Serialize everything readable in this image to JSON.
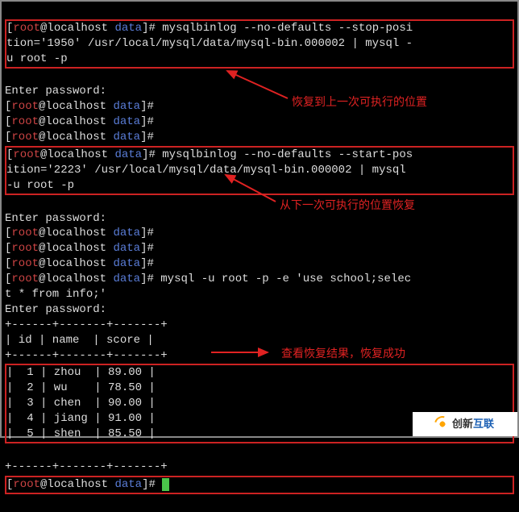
{
  "prompt": {
    "user": "root",
    "host": "localhost",
    "dir": "data"
  },
  "cmd1": "mysqlbinlog --no-defaults --stop-position='1950' /usr/local/mysql/data/mysql-bin.000002 | mysql -u root -p",
  "enter_pw": "Enter password:",
  "cmd2": "mysqlbinlog --no-defaults --start-position='2223' /usr/local/mysql/data/mysql-bin.000002 | mysql -u root -p",
  "cmd3": "mysql -u root -p -e 'use school;select * from info;'",
  "table": {
    "sep": "+------+-------+-------+",
    "head": "| id | name  | score |",
    "rows": [
      "|  1 | zhou  | 89.00 |",
      "|  2 | wu    | 78.50 |",
      "|  3 | chen  | 90.00 |",
      "|  4 | jiang | 91.00 |",
      "|  5 | shen  | 85.50 |"
    ]
  },
  "chart_data": {
    "type": "table",
    "columns": [
      "id",
      "name",
      "score"
    ],
    "rows": [
      [
        1,
        "zhou",
        89.0
      ],
      [
        2,
        "wu",
        78.5
      ],
      [
        3,
        "chen",
        90.0
      ],
      [
        4,
        "jiang",
        91.0
      ],
      [
        5,
        "shen",
        85.5
      ]
    ]
  },
  "anno1": "恢复到上一次可执行的位置",
  "anno2": "从下一次可执行的位置恢复",
  "anno3": "查看恢复结果，恢复成功",
  "watermark": {
    "t1": "创新",
    "t2": "互联"
  }
}
